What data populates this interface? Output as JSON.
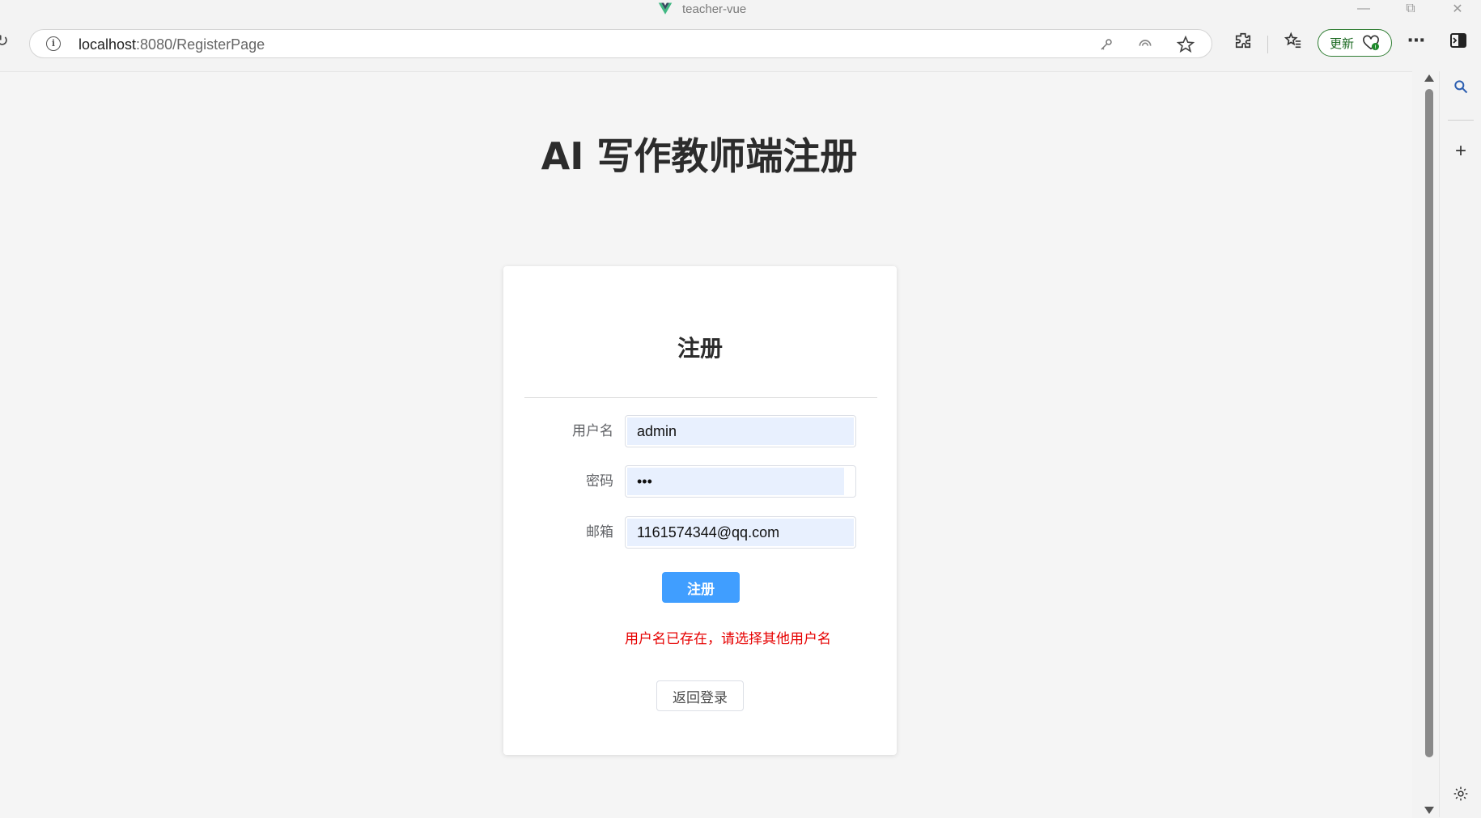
{
  "window": {
    "title": "teacher-vue"
  },
  "browser": {
    "url_host": "localhost",
    "url_rest": ":8080/RegisterPage",
    "update_label": "更新"
  },
  "page": {
    "title": "AI 写作教师端注册"
  },
  "card": {
    "title": "注册",
    "fields": {
      "username": {
        "label": "用户名",
        "value": "admin"
      },
      "password": {
        "label": "密码",
        "value": "•••"
      },
      "email": {
        "label": "邮箱",
        "value": "1161574344@qq.com"
      }
    },
    "submit_label": "注册",
    "error_message": "用户名已存在，请选择其他用户名",
    "back_label": "返回登录"
  },
  "colors": {
    "primary": "#409eff",
    "error": "#e60000",
    "update_green": "#2f7d32"
  }
}
